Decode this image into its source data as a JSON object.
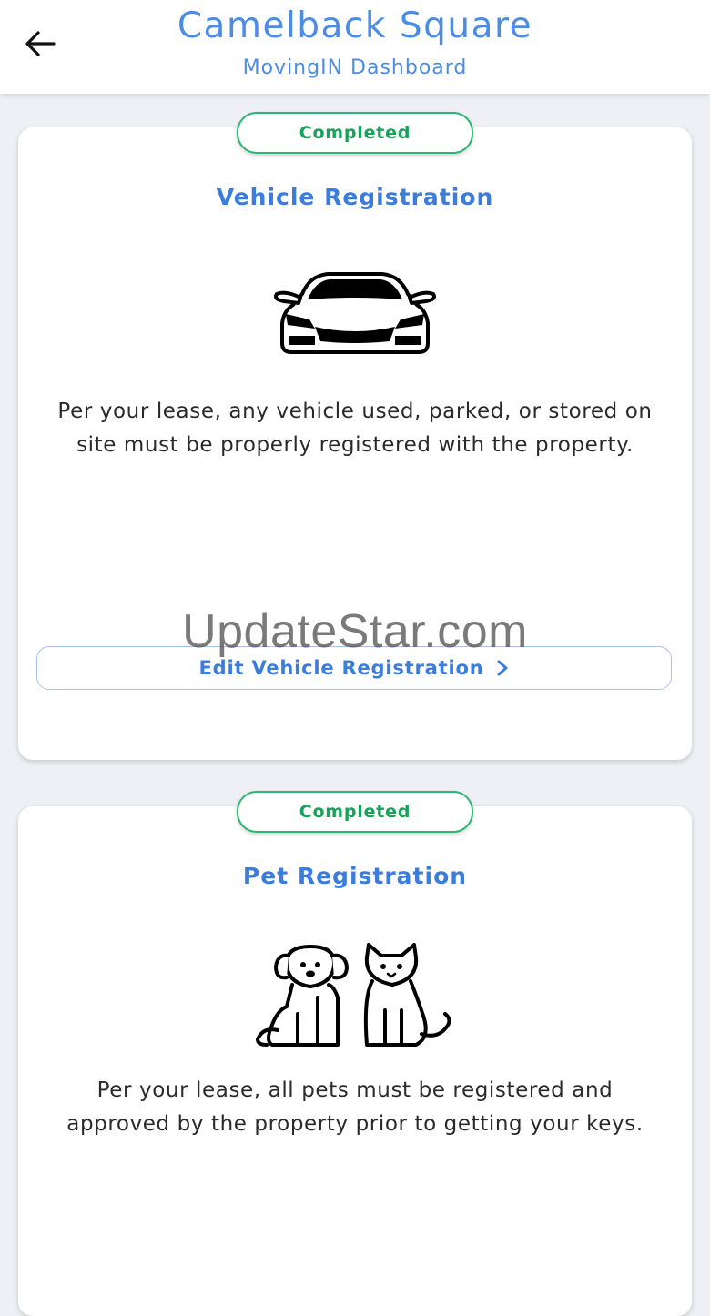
{
  "header": {
    "title": "Camelback Square",
    "subtitle": "MovingIN Dashboard",
    "back_icon": "arrow-left-icon"
  },
  "cards": [
    {
      "status": "Completed",
      "title": "Vehicle Registration",
      "icon": "car-icon",
      "description": "Per your lease, any vehicle used, parked, or stored on site must be properly registered with the property.",
      "button_label": "Edit Vehicle Registration"
    },
    {
      "status": "Completed",
      "title": "Pet Registration",
      "icon": "dog-and-cat-icon",
      "description": "Per your lease, all pets must be registered and approved by the property prior to getting your keys."
    }
  ],
  "watermark": "UpdateStar.com",
  "colors": {
    "accent": "#3b7ddd",
    "header_text": "#4b8de6",
    "status_green": "#19a35a",
    "background": "#eef0f5"
  }
}
